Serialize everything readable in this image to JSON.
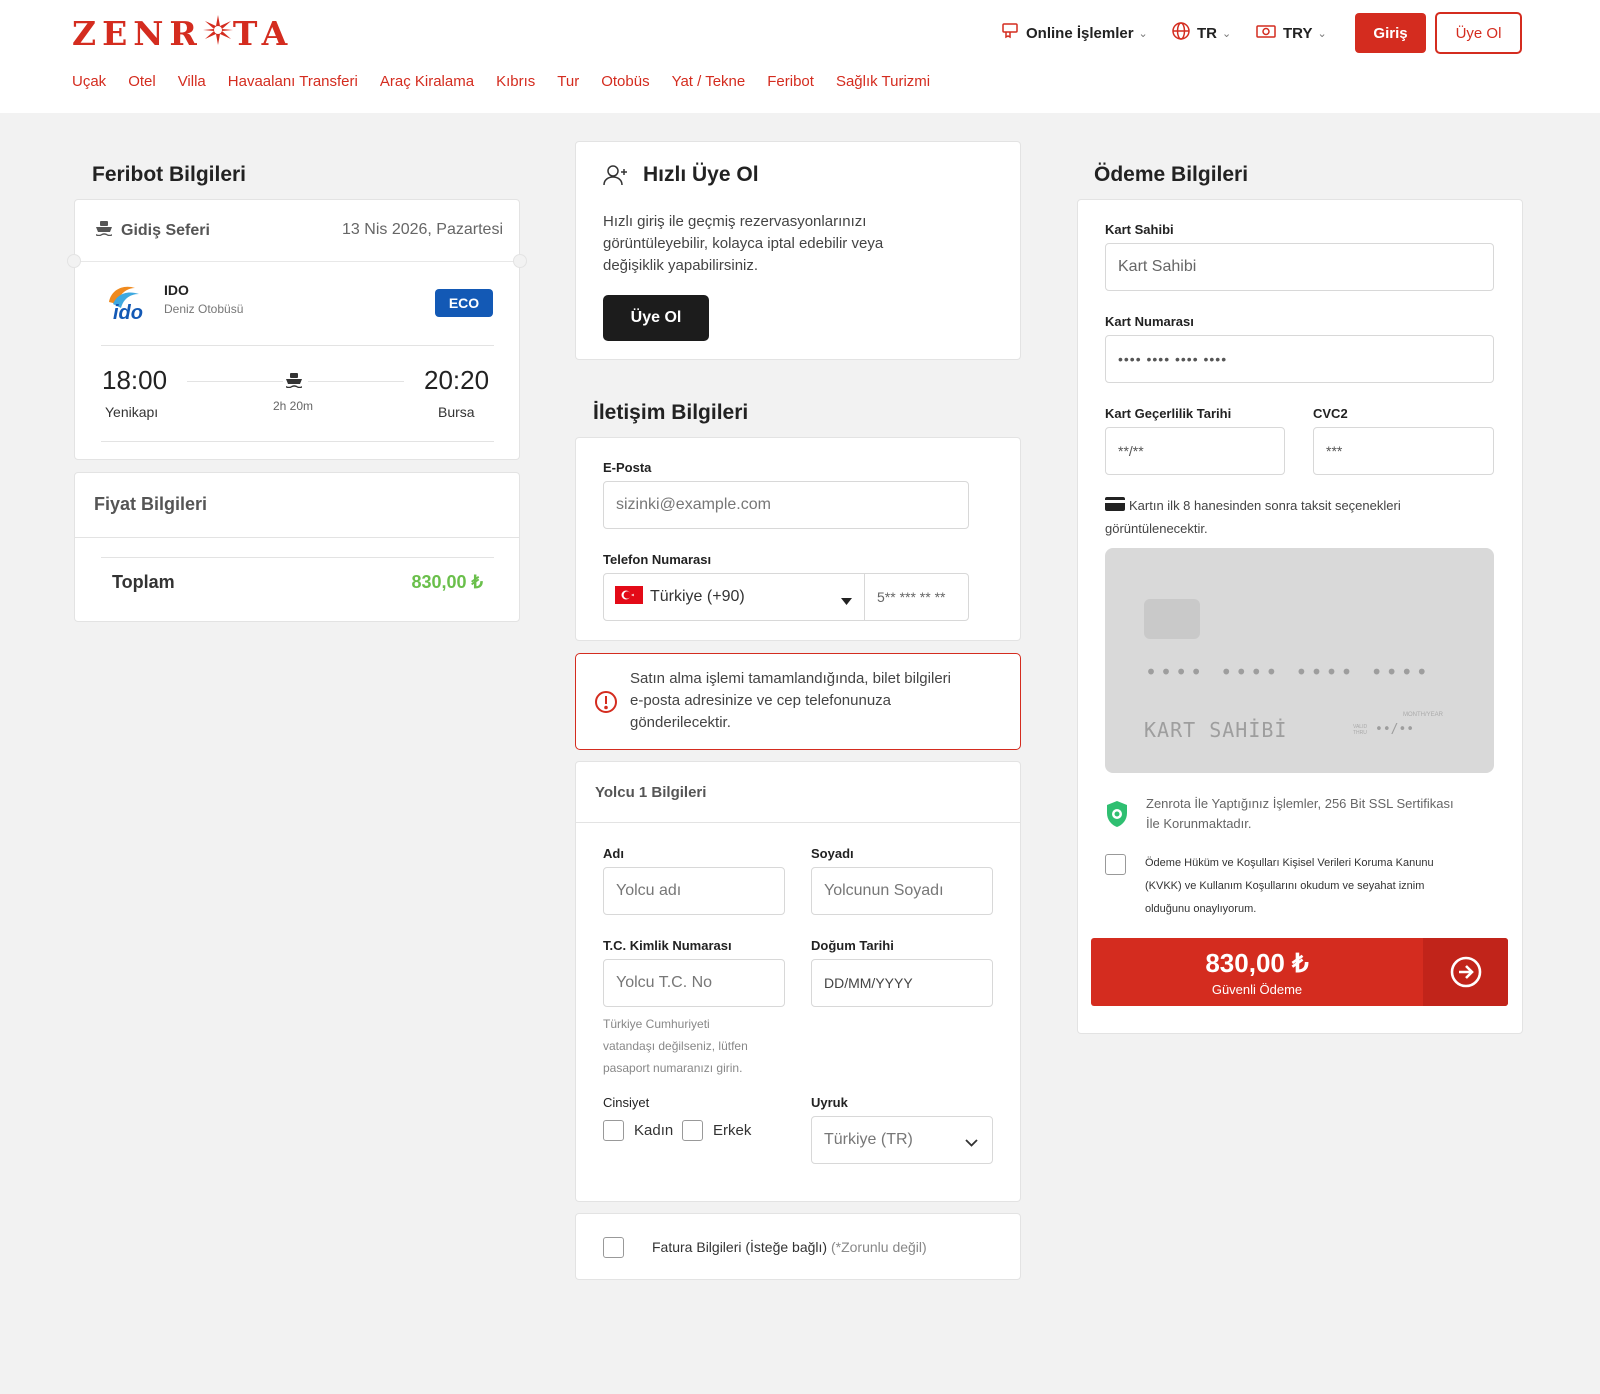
{
  "brand": {
    "logo_left": "ZEN",
    "logo_mid": "R",
    "logo_right": "TA",
    "accent": "#d42c1f"
  },
  "topnav": {
    "online": "Online İşlemler",
    "lang": "TR",
    "currency": "TRY",
    "login": "Giriş",
    "signup": "Üye Ol"
  },
  "categories": [
    "Uçak",
    "Otel",
    "Villa",
    "Havaalanı Transferi",
    "Araç Kiralama",
    "Kıbrıs",
    "Tur",
    "Otobüs",
    "Yat / Tekne",
    "Feribot",
    "Sağlık Turizmi"
  ],
  "ferry": {
    "title": "Feribot Bilgileri",
    "leg_label": "Gidiş Seferi",
    "date": "13 Nis 2026, Pazartesi",
    "logo_text": "ido",
    "company": "IDO",
    "company_sub": "Deniz Otobüsü",
    "class_badge": "ECO",
    "dep_time": "18:00",
    "dep_place": "Yenikapı",
    "arr_time": "20:20",
    "arr_place": "Bursa",
    "duration": "2h 20m"
  },
  "price": {
    "title": "Fiyat Bilgileri",
    "total_label": "Toplam",
    "total": "830,00 ₺"
  },
  "quick_signup": {
    "title": "Hızlı Üye Ol",
    "text_1": "Hızlı giriş ile geçmiş rezervasyonlarınızı",
    "text_2": "görüntüleyebilir, kolayca iptal edebilir veya",
    "text_3": "değişiklik yapabilirsiniz.",
    "button": "Üye Ol"
  },
  "contact": {
    "title": "İletişim Bilgileri",
    "email_label": "E-Posta",
    "email_placeholder": "sizinki@example.com",
    "phone_label": "Telefon Numarası",
    "country": "Türkiye (+90)",
    "phone_placeholder": "5** *** ** **"
  },
  "notice": {
    "line_1": "Satın alma işlemi tamamlandığında, bilet bilgileri",
    "line_2": "e-posta adresinize ve cep telefonunuza",
    "line_3": "gönderilecektir."
  },
  "passenger": {
    "title": "Yolcu 1 Bilgileri",
    "first_label": "Adı",
    "first_placeholder": "Yolcu adı",
    "last_label": "Soyadı",
    "last_placeholder": "Yolcunun Soyadı",
    "tc_label": "T.C. Kimlik Numarası",
    "tc_placeholder": "Yolcu T.C. No",
    "tc_hint_1": "Türkiye Cumhuriyeti",
    "tc_hint_2": "vatandaşı değilseniz, lütfen",
    "tc_hint_3": "pasaport numaranızı girin.",
    "dob_label": "Doğum Tarihi",
    "dob_placeholder": "DD/MM/YYYY",
    "gender_label": "Cinsiyet",
    "female": "Kadın",
    "male": "Erkek",
    "nationality_label": "Uyruk",
    "nationality": "Türkiye (TR)"
  },
  "invoice": {
    "label": "Fatura Bilgileri (İsteğe bağlı)",
    "note": "(*Zorunlu değil)"
  },
  "payment": {
    "title": "Ödeme Bilgileri",
    "holder_label": "Kart Sahibi",
    "holder_placeholder": "Kart Sahibi",
    "number_label": "Kart Numarası",
    "number_placeholder": "•••• •••• •••• ••••",
    "expiry_label": "Kart Geçerlilik Tarihi",
    "expiry_placeholder": "**/**",
    "cvc_label": "CVC2",
    "cvc_placeholder": "***",
    "installment_1": "Kartın ilk 8 hanesinden sonra taksit seçenekleri",
    "installment_2": "görüntülenecektir.",
    "card_number": "•••• •••• •••• ••••",
    "card_holder": "KART SAHİBİ",
    "card_exp_top": "MONTH/YEAR",
    "card_exp_left": "VALID THRU",
    "card_exp": "••/••",
    "ssl_1": "Zenrota İle Yaptığınız İşlemler, 256 Bit SSL Sertifikası",
    "ssl_2": "İle Korunmaktadır.",
    "terms_1": "Ödeme Hüküm ve Koşulları Kişisel Verileri Koruma Kanunu",
    "terms_2": "(KVKK) ve Kullanım Koşullarını okudum ve seyahat iznim",
    "terms_3": "olduğunu onaylıyorum.",
    "pay_amount": "830,00 ₺",
    "pay_sub": "Güvenli Ödeme"
  }
}
